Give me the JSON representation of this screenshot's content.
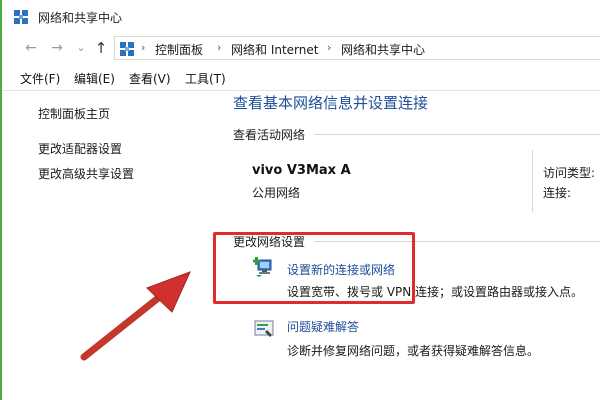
{
  "window": {
    "title": "网络和共享中心"
  },
  "address": {
    "breadcrumb": [
      "控制面板",
      "网络和 Internet",
      "网络和共享中心"
    ],
    "separator": "›"
  },
  "nav": {
    "back": "←",
    "forward": "→",
    "recent": "⌄",
    "up": "↑"
  },
  "menubar": {
    "items": [
      "文件(F)",
      "编辑(E)",
      "查看(V)",
      "工具(T)"
    ]
  },
  "sidebar": {
    "items": [
      {
        "label": "控制面板主页"
      },
      {
        "label": "更改适配器设置"
      },
      {
        "label": "更改高级共享设置"
      }
    ]
  },
  "main": {
    "heading": "查看基本网络信息并设置连接",
    "active_networks_label": "查看活动网络",
    "network": {
      "name": "vivo V3Max A",
      "type": "公用网络",
      "access_type_label": "访问类型:",
      "connection_label": "连接:"
    },
    "change_settings_label": "更改网络设置",
    "tasks": [
      {
        "title": "设置新的连接或网络",
        "description": "设置宽带、拨号或 VPN 连接；或设置路由器或接入点。",
        "icon": "new-connection-icon"
      },
      {
        "title": "问题疑难解答",
        "description": "诊断并修复网络问题，或者获得疑难解答信息。",
        "icon": "troubleshoot-icon"
      }
    ]
  },
  "colors": {
    "link": "#1e4e9a",
    "annotation": "#e02b2b",
    "window_edge": "#4cae3c"
  }
}
